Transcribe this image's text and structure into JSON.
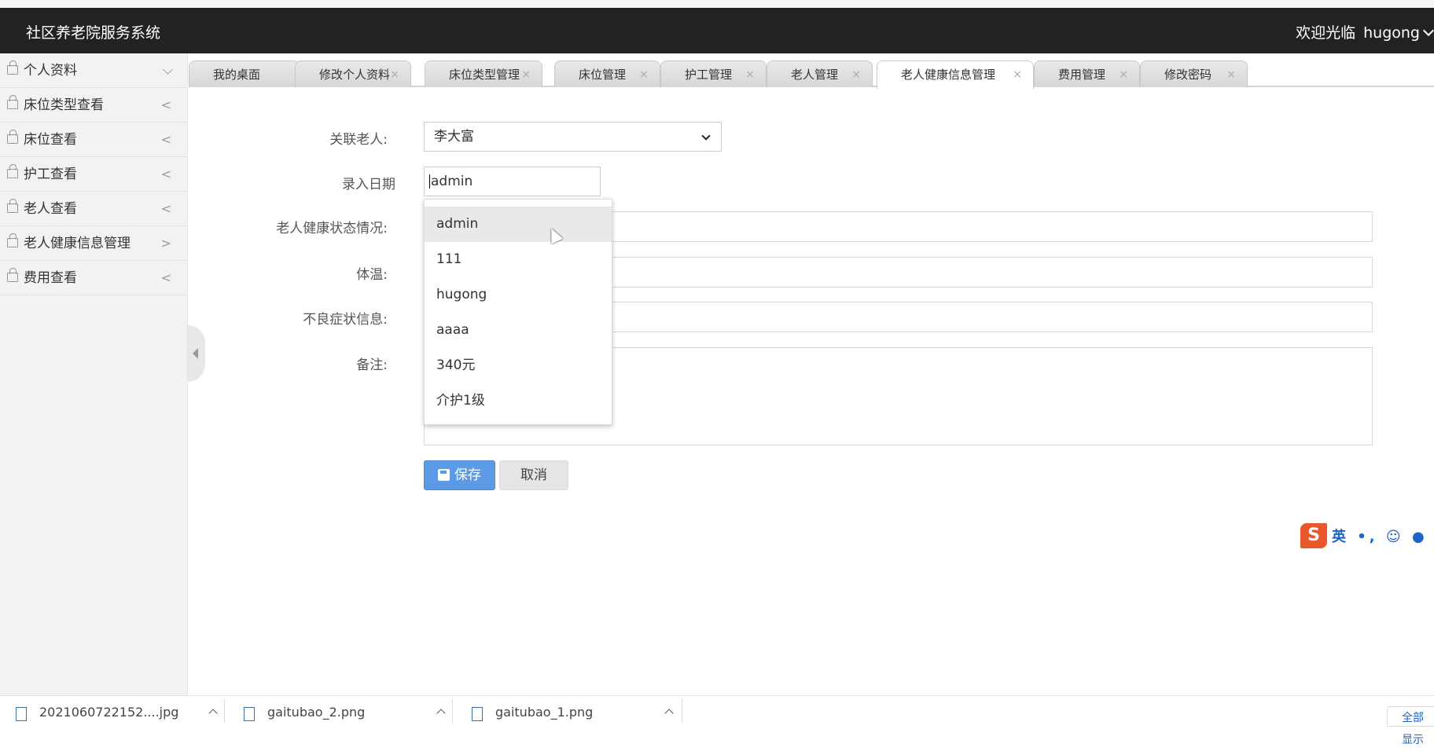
{
  "header": {
    "title": "社区养老院服务系统",
    "welcome": "欢迎光临",
    "username": "hugong"
  },
  "sidebar": {
    "items": [
      {
        "label": "个人资料",
        "arrow": "down"
      },
      {
        "label": "床位类型查看",
        "arrow": "<"
      },
      {
        "label": "床位查看",
        "arrow": "<"
      },
      {
        "label": "护工查看",
        "arrow": "<"
      },
      {
        "label": "老人查看",
        "arrow": "<"
      },
      {
        "label": "老人健康信息管理",
        "arrow": ">"
      },
      {
        "label": "费用查看",
        "arrow": "<"
      }
    ]
  },
  "tabs": [
    {
      "label": "我的桌面",
      "closable": false
    },
    {
      "label": "修改个人资料",
      "closable": true
    },
    {
      "label": "床位类型管理",
      "closable": true
    },
    {
      "label": "床位管理",
      "closable": true
    },
    {
      "label": "护工管理",
      "closable": true
    },
    {
      "label": "老人管理",
      "closable": true
    },
    {
      "label": "老人健康信息管理",
      "closable": true,
      "active": true
    },
    {
      "label": "费用管理",
      "closable": true
    },
    {
      "label": "修改密码",
      "closable": true
    }
  ],
  "tab_close_glyph": "×",
  "form": {
    "elder_label": "关联老人:",
    "elder_value": "李大富",
    "date_label": "录入日期",
    "date_value": "admin",
    "health_label": "老人健康状态情况:",
    "temp_label": "体温:",
    "symptom_label": "不良症状信息:",
    "remark_label": "备注:",
    "save_label": "保存",
    "cancel_label": "取消"
  },
  "autocomplete": {
    "options": [
      "admin",
      "111",
      "hugong",
      "aaaa",
      "340元",
      "介护1级"
    ],
    "hovered_index": 0
  },
  "ime": {
    "logo": "S",
    "mode": "英"
  },
  "downloads": {
    "items": [
      "2021060722152....jpg",
      "gaitubao_2.png",
      "gaitubao_1.png"
    ],
    "show_all": "全部显示"
  },
  "colors": {
    "topbar": "#222222",
    "save_button": "#5c9ae6",
    "ime_logo": "#e8582a"
  }
}
